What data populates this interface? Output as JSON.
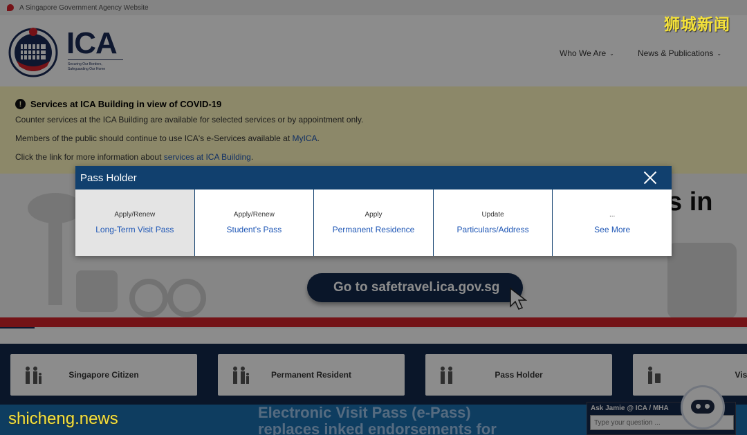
{
  "gov_bar": {
    "text": "A Singapore Government Agency Website"
  },
  "header": {
    "logo_text": "ICA",
    "logo_tagline_1": "Securing Our Borders,",
    "logo_tagline_2": "Safeguarding Our Home",
    "nav": [
      {
        "label": "Who We Are"
      },
      {
        "label": "News & Publications"
      }
    ]
  },
  "notice": {
    "title": "Services at ICA Building in view of COVID-19",
    "line1": "Counter services at the ICA Building are available for selected services or by appointment only.",
    "line2_prefix": "Members of the public should continue to use ICA's e-Services available at ",
    "line2_link": "MyICA",
    "line2_suffix": ".",
    "line3_prefix": "Click the link for more information about ",
    "line3_link": "services at ICA Building",
    "line3_suffix": "."
  },
  "hero": {
    "cta_label": "Go to safetravel.ica.gov.sg",
    "partial_text": "s in"
  },
  "categories": [
    {
      "label": "Singapore Citizen"
    },
    {
      "label": "Permanent Resident"
    },
    {
      "label": "Pass Holder"
    },
    {
      "label": "Visito"
    }
  ],
  "banner": {
    "line1": "Electronic Visit Pass (e-Pass)",
    "line2": "replaces inked endorsements for"
  },
  "chat": {
    "title": "Ask Jamie @ ICA / MHA",
    "placeholder": "Type your question ..."
  },
  "modal": {
    "title": "Pass Holder",
    "options": [
      {
        "action": "Apply/Renew",
        "service": "Long-Term Visit Pass"
      },
      {
        "action": "Apply/Renew",
        "service": "Student's Pass"
      },
      {
        "action": "Apply",
        "service": "Permanent Residence"
      },
      {
        "action": "Update",
        "service": "Particulars/Address"
      },
      {
        "action": "...",
        "service": "See More"
      }
    ]
  },
  "watermark": {
    "top": "狮城新闻",
    "bottom": "shicheng.news"
  },
  "colors": {
    "modal_header": "#11406e",
    "link": "#1e56b5",
    "notice_bg": "#fff8c0",
    "navy": "#13294b",
    "red": "#d4232b"
  }
}
